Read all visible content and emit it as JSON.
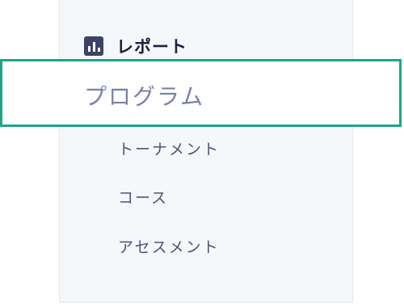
{
  "sidebar": {
    "section": {
      "icon": "bar-chart-icon",
      "title": "レポート"
    },
    "selected_item": {
      "label": "プログラム",
      "highlight_color": "#1aa785"
    },
    "sub_items": [
      {
        "label": "トーナメント"
      },
      {
        "label": "コース"
      },
      {
        "label": "アセスメント"
      }
    ]
  },
  "colors": {
    "sidebar_background": "#f6f7fb",
    "icon_background": "#3d4266",
    "selected_text": "#7a80a6",
    "item_text": "#4f5577"
  }
}
